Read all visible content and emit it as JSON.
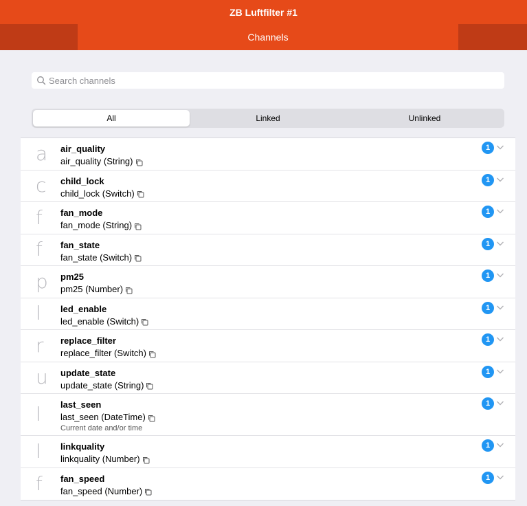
{
  "header": {
    "title": "ZB Luftfilter #1",
    "tab": "Channels"
  },
  "search": {
    "placeholder": "Search channels",
    "value": ""
  },
  "filter": {
    "options": [
      "All",
      "Linked",
      "Unlinked"
    ],
    "selected": "All"
  },
  "colors": {
    "accent": "#e64a19",
    "accent_dark": "#bf3b16",
    "badge": "#2196f3"
  },
  "channels": [
    {
      "letter": "a",
      "name": "air_quality",
      "detail": "air_quality (String)",
      "links": "1"
    },
    {
      "letter": "c",
      "name": "child_lock",
      "detail": "child_lock (Switch)",
      "links": "1"
    },
    {
      "letter": "f",
      "name": "fan_mode",
      "detail": "fan_mode (String)",
      "links": "1"
    },
    {
      "letter": "f",
      "name": "fan_state",
      "detail": "fan_state (Switch)",
      "links": "1"
    },
    {
      "letter": "p",
      "name": "pm25",
      "detail": "pm25 (Number)",
      "links": "1"
    },
    {
      "letter": "l",
      "name": "led_enable",
      "detail": "led_enable (Switch)",
      "links": "1"
    },
    {
      "letter": "r",
      "name": "replace_filter",
      "detail": "replace_filter (Switch)",
      "links": "1"
    },
    {
      "letter": "u",
      "name": "update_state",
      "detail": "update_state (String)",
      "links": "1"
    },
    {
      "letter": "l",
      "name": "last_seen",
      "detail": "last_seen (DateTime)",
      "description": "Current date and/or time",
      "links": "1"
    },
    {
      "letter": "l",
      "name": "linkquality",
      "detail": "linkquality (Number)",
      "links": "1"
    },
    {
      "letter": "f",
      "name": "fan_speed",
      "detail": "fan_speed (Number)",
      "links": "1"
    }
  ]
}
